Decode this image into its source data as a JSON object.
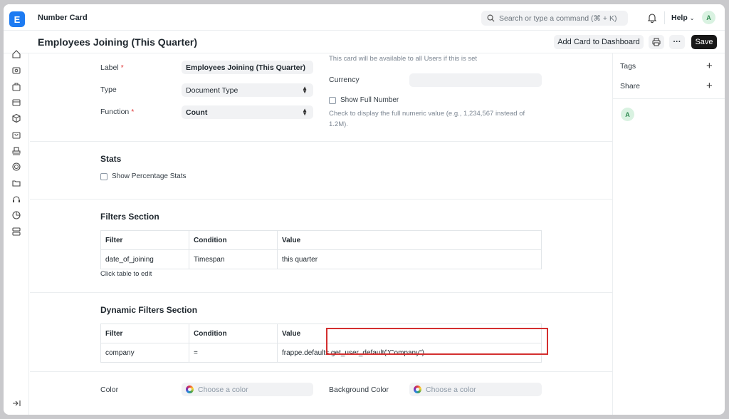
{
  "topbar": {
    "logo_letter": "E",
    "app_title": "Number Card",
    "search_placeholder": "Search or type a command (⌘ + K)",
    "help_label": "Help",
    "avatar_letter": "A"
  },
  "page": {
    "title": "Employees Joining (This Quarter)",
    "add_card_label": "Add Card to Dashboard",
    "more_label": "···",
    "save_label": "Save"
  },
  "form": {
    "label_label": "Label",
    "label_value": "Employees Joining (This Quarter)",
    "type_label": "Type",
    "type_value": "Document Type",
    "function_label": "Function",
    "function_value": "Count",
    "required_mark": "*",
    "availability_note": "This card will be available to all Users if this is set",
    "currency_label": "Currency",
    "currency_value": "",
    "show_full_number_label": "Show Full Number",
    "show_full_number_help": "Check to display the full numeric value (e.g., 1,234,567 instead of 1.2M)."
  },
  "stats": {
    "title": "Stats",
    "show_percentage_label": "Show Percentage Stats"
  },
  "filters": {
    "title": "Filters Section",
    "columns": [
      "Filter",
      "Condition",
      "Value"
    ],
    "rows": [
      [
        "date_of_joining",
        "Timespan",
        "this quarter"
      ]
    ],
    "edit_hint": "Click table to edit"
  },
  "dynamic_filters": {
    "title": "Dynamic Filters Section",
    "columns": [
      "Filter",
      "Condition",
      "Value"
    ],
    "rows": [
      [
        "company",
        "=",
        "frappe.defaults.get_user_default(\"Company\")"
      ]
    ]
  },
  "colors": {
    "color_label": "Color",
    "color_placeholder": "Choose a color",
    "bg_color_label": "Background Color",
    "bg_color_placeholder": "Choose a color",
    "highlight": "#d32f2f"
  },
  "right_panel": {
    "tags_label": "Tags",
    "share_label": "Share",
    "avatar_letter": "A"
  }
}
